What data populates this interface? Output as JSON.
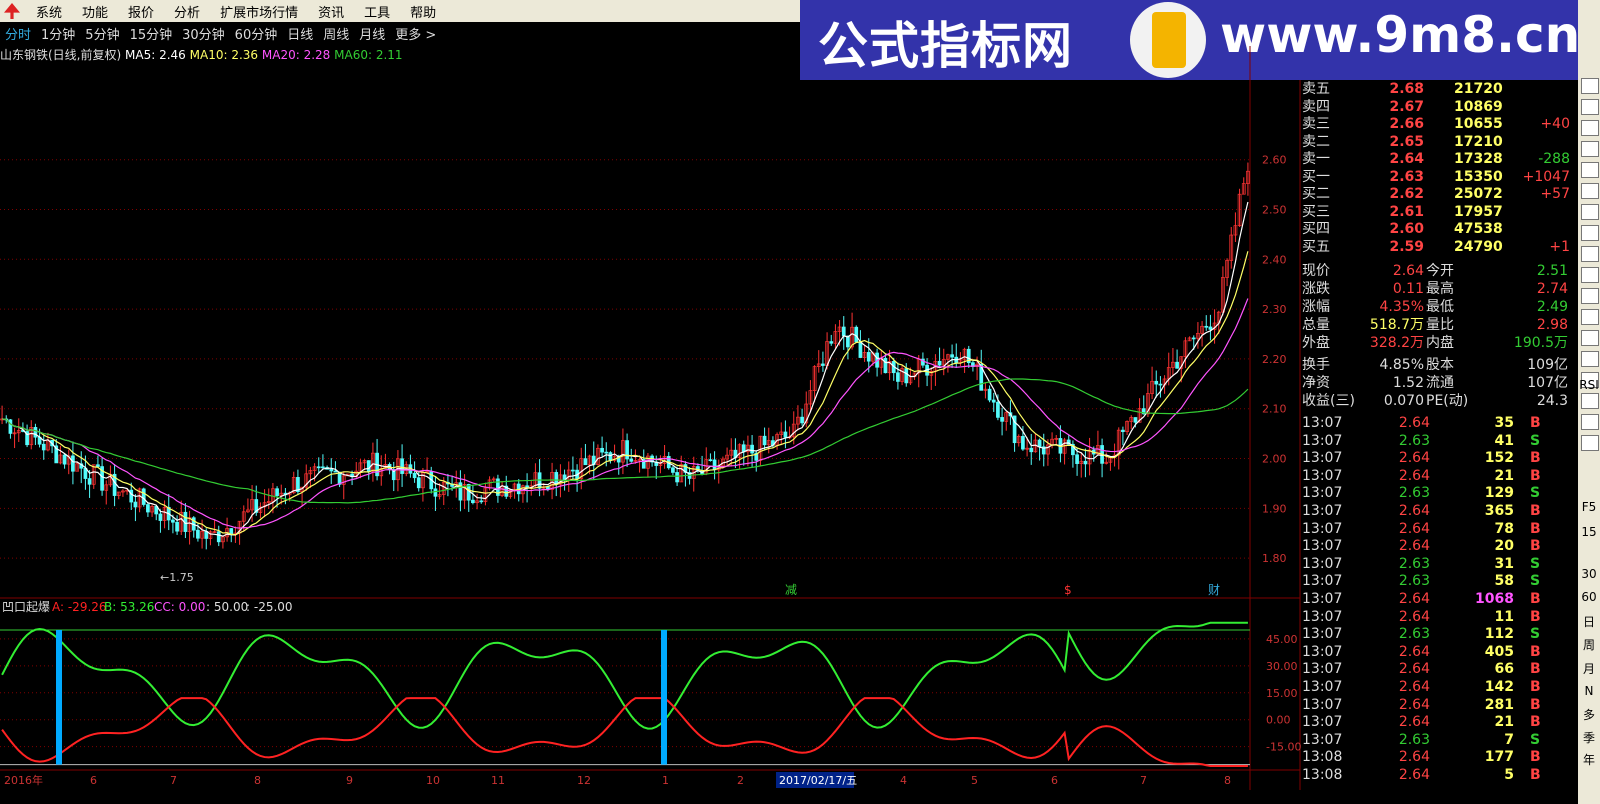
{
  "menu": [
    "系统",
    "功能",
    "报价",
    "分析",
    "扩展市场行情",
    "资讯",
    "工具",
    "帮助"
  ],
  "periods": [
    "分时",
    "1分钟",
    "5分钟",
    "15分钟",
    "30分钟",
    "60分钟",
    "日线",
    "周线",
    "月线",
    "更多 >"
  ],
  "active_period": "分时",
  "banner": {
    "title": "公式指标网",
    "url": "www.9m8.cn"
  },
  "stock_line": {
    "name": "山东钢铁(日线,前复权)",
    "ma5": "MA5: 2.46",
    "ma10": "MA10: 2.36",
    "ma20": "MA20: 2.28",
    "ma60": "MA60: 2.11"
  },
  "colors": {
    "up": "#ff3333",
    "down": "#54fcfc",
    "ma5": "#ffffff",
    "ma10": "#ffff66",
    "ma20": "#ff55ff",
    "ma60": "#33cc33",
    "lineA": "#ff2222",
    "lineB": "#33ee33",
    "cc": "#00aaff",
    "grid": "#800000"
  },
  "price_axis": {
    "ticks": [
      "2.60",
      "2.50",
      "2.40",
      "2.30",
      "2.20",
      "2.10",
      "2.00",
      "1.90",
      "1.80"
    ],
    "min": 1.72,
    "max": 2.76
  },
  "low_label": "1.75",
  "markers": [
    "减",
    "$",
    "财"
  ],
  "indicator": {
    "name": "凹口起爆",
    "a": "A: -29.26",
    "b": "B: 53.26",
    "cc": "CC: 0.00",
    "c50": ": 50.00",
    "c25": ": -25.00",
    "ticks": [
      "45.00",
      "30.00",
      "15.00",
      "0.00",
      "-15.00"
    ]
  },
  "date_axis": {
    "labels": [
      "2016年",
      "6",
      "7",
      "8",
      "9",
      "10",
      "11",
      "12",
      "1",
      "2",
      "4",
      "5",
      "6",
      "7",
      "8"
    ],
    "highlight": "2017/02/17/五"
  },
  "quote": {
    "asks": [
      [
        "卖五",
        "2.68",
        "21720",
        ""
      ],
      [
        "卖四",
        "2.67",
        "10869",
        ""
      ],
      [
        "卖三",
        "2.66",
        "10655",
        "+40"
      ],
      [
        "卖二",
        "2.65",
        "17210",
        ""
      ],
      [
        "卖一",
        "2.64",
        "17328",
        "-288"
      ]
    ],
    "bids": [
      [
        "买一",
        "2.63",
        "15350",
        "+1047"
      ],
      [
        "买二",
        "2.62",
        "25072",
        "+57"
      ],
      [
        "买三",
        "2.61",
        "17957",
        ""
      ],
      [
        "买四",
        "2.60",
        "47538",
        ""
      ],
      [
        "买五",
        "2.59",
        "24790",
        "+1"
      ]
    ],
    "stats": [
      [
        "现价",
        "2.64",
        "今开",
        "2.51"
      ],
      [
        "涨跌",
        "0.11",
        "最高",
        "2.74"
      ],
      [
        "涨幅",
        "4.35%",
        "最低",
        "2.49"
      ],
      [
        "总量",
        "518.7万",
        "量比",
        "2.98"
      ],
      [
        "外盘",
        "328.2万",
        "内盘",
        "190.5万"
      ]
    ],
    "stats2": [
      [
        "换手",
        "4.85%",
        "股本",
        "109亿"
      ],
      [
        "净资",
        "1.52",
        "流通",
        "107亿"
      ],
      [
        "收益(三)",
        "0.070",
        "PE(动)",
        "24.3"
      ]
    ],
    "ticks": [
      [
        "13:07",
        "2.64",
        "35",
        "B"
      ],
      [
        "13:07",
        "2.63",
        "41",
        "S"
      ],
      [
        "13:07",
        "2.64",
        "152",
        "B"
      ],
      [
        "13:07",
        "2.64",
        "21",
        "B"
      ],
      [
        "13:07",
        "2.63",
        "129",
        "S"
      ],
      [
        "13:07",
        "2.64",
        "365",
        "B"
      ],
      [
        "13:07",
        "2.64",
        "78",
        "B"
      ],
      [
        "13:07",
        "2.64",
        "20",
        "B"
      ],
      [
        "13:07",
        "2.63",
        "31",
        "S"
      ],
      [
        "13:07",
        "2.63",
        "58",
        "S"
      ],
      [
        "13:07",
        "2.64",
        "1068",
        "B"
      ],
      [
        "13:07",
        "2.64",
        "11",
        "B"
      ],
      [
        "13:07",
        "2.63",
        "112",
        "S"
      ],
      [
        "13:07",
        "2.64",
        "405",
        "B"
      ],
      [
        "13:07",
        "2.64",
        "66",
        "B"
      ],
      [
        "13:07",
        "2.64",
        "142",
        "B"
      ],
      [
        "13:07",
        "2.64",
        "281",
        "B"
      ],
      [
        "13:07",
        "2.64",
        "21",
        "B"
      ],
      [
        "13:07",
        "2.63",
        "7",
        "S"
      ],
      [
        "13:08",
        "2.64",
        "177",
        "B"
      ],
      [
        "13:08",
        "2.64",
        "5",
        "B"
      ]
    ]
  },
  "side_tabs": [
    "RSI",
    "F5",
    "15",
    "30",
    "60",
    "日",
    "周",
    "月",
    "N",
    "多",
    "季",
    "年"
  ]
}
